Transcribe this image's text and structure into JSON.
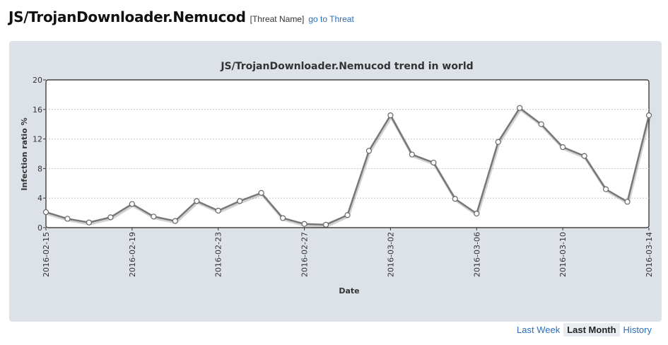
{
  "header": {
    "title": "JS/TrojanDownloader.Nemucod",
    "tag": "[Threat Name]",
    "link": "go to Threat"
  },
  "range_tabs": [
    {
      "label": "Last Week",
      "active": false
    },
    {
      "label": "Last Month",
      "active": true
    },
    {
      "label": "History",
      "active": false
    }
  ],
  "colors": {
    "panel_bg": "#dde1e8",
    "line": "#777777",
    "link": "#2a6ebb"
  },
  "chart_data": {
    "type": "line",
    "title": "JS/TrojanDownloader.Nemucod trend in world",
    "xlabel": "Date",
    "ylabel": "Infection ratio %",
    "ylim": [
      0,
      20
    ],
    "yticks": [
      0,
      4,
      8,
      12,
      16,
      20
    ],
    "grid": true,
    "x": [
      "2016-02-15",
      "2016-02-16",
      "2016-02-17",
      "2016-02-18",
      "2016-02-19",
      "2016-02-20",
      "2016-02-21",
      "2016-02-22",
      "2016-02-23",
      "2016-02-24",
      "2016-02-25",
      "2016-02-26",
      "2016-02-27",
      "2016-02-28",
      "2016-02-29",
      "2016-03-01",
      "2016-03-02",
      "2016-03-03",
      "2016-03-04",
      "2016-03-05",
      "2016-03-06",
      "2016-03-07",
      "2016-03-08",
      "2016-03-09",
      "2016-03-10",
      "2016-03-11",
      "2016-03-12",
      "2016-03-13",
      "2016-03-14"
    ],
    "xtick_labels": [
      "2016-02-15",
      "2016-02-19",
      "2016-02-23",
      "2016-02-27",
      "2016-03-02",
      "2016-03-06",
      "2016-03-10",
      "2016-03-14"
    ],
    "values": [
      2.1,
      1.2,
      0.7,
      1.4,
      3.2,
      1.5,
      0.9,
      3.6,
      2.3,
      3.6,
      4.7,
      1.3,
      0.5,
      0.4,
      1.7,
      10.4,
      15.2,
      9.9,
      8.8,
      3.9,
      1.9,
      11.6,
      16.2,
      14.0,
      10.9,
      9.7,
      5.2,
      3.5,
      15.2
    ]
  }
}
